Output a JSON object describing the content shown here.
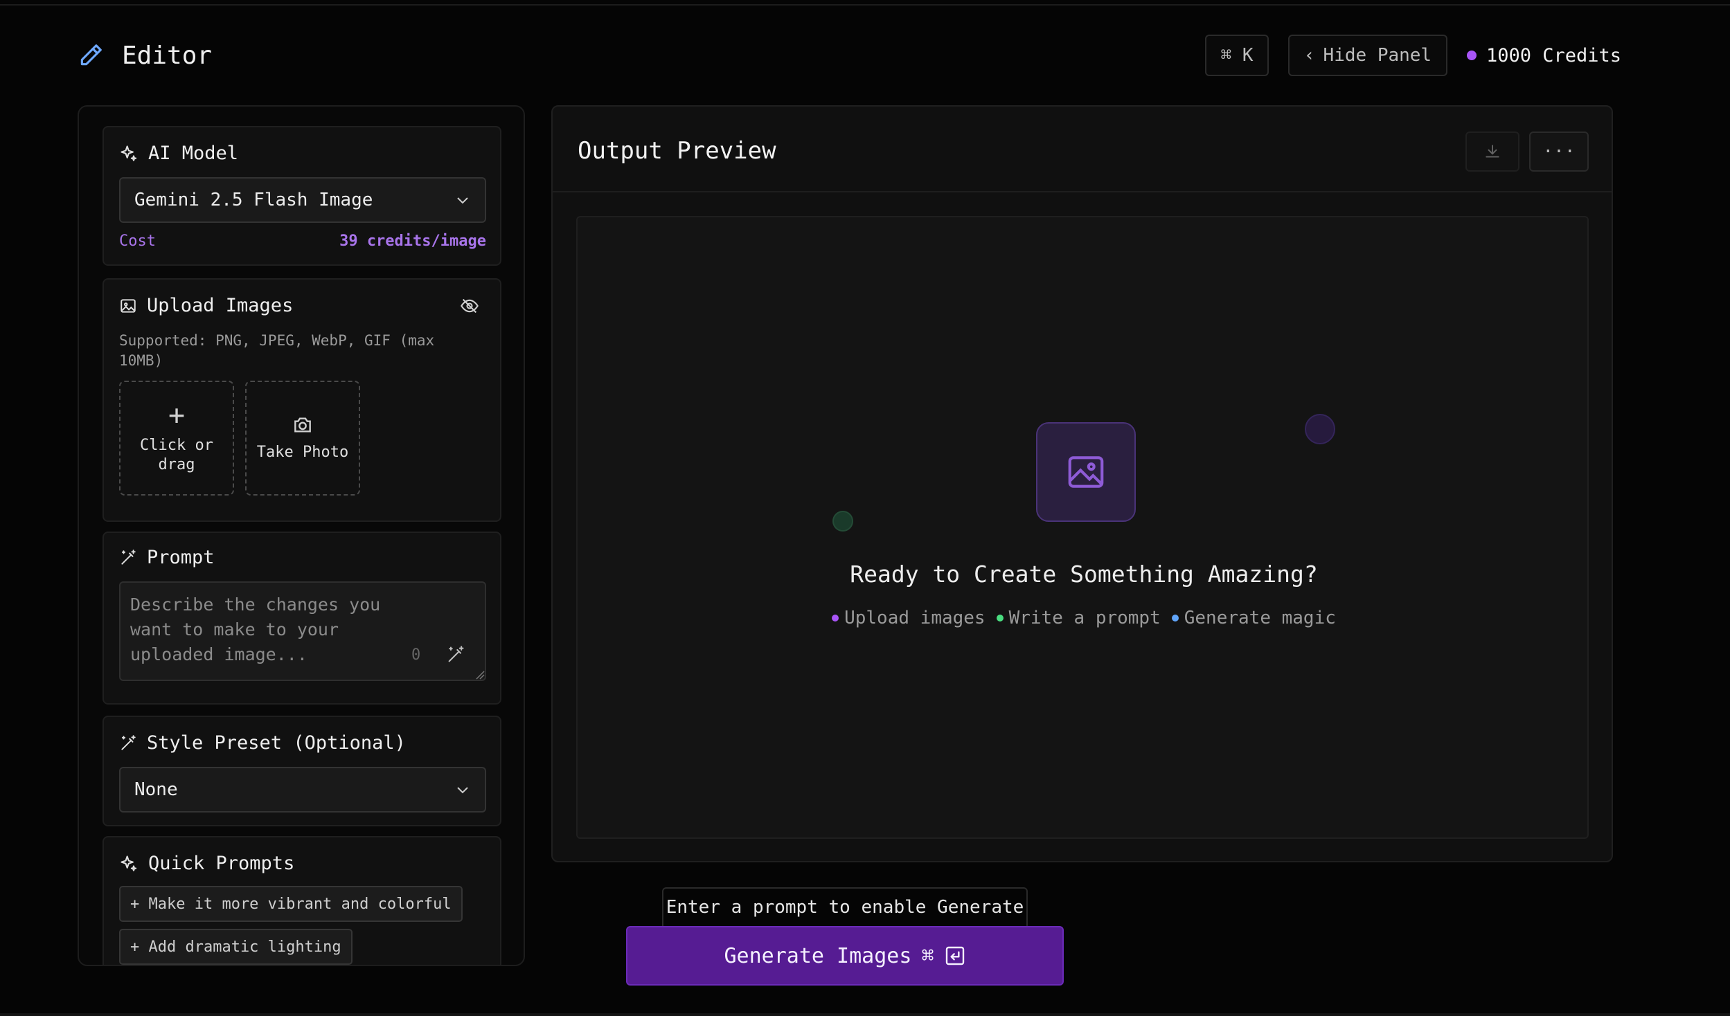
{
  "header": {
    "title": "Editor",
    "shortcut_label": "⌘ K",
    "hide_panel_label": "Hide Panel",
    "credits_label": "1000 Credits"
  },
  "ai_model": {
    "heading": "AI Model",
    "selected": "Gemini 2.5 Flash Image",
    "cost_label": "Cost",
    "cost_value": "39 credits/image"
  },
  "upload": {
    "heading": "Upload Images",
    "supported": "Supported: PNG, JPEG, WebP, GIF (max 10MB)",
    "click_label": "Click or drag",
    "photo_label": "Take Photo"
  },
  "prompt": {
    "heading": "Prompt",
    "placeholder": "Describe the changes you want to make to your uploaded image...",
    "count": "0"
  },
  "style_preset": {
    "heading": "Style Preset (Optional)",
    "selected": "None"
  },
  "quick_prompts": {
    "heading": "Quick Prompts",
    "items": [
      "+ Make it more vibrant and colorful",
      "+ Add dramatic lighting"
    ]
  },
  "output": {
    "title": "Output Preview",
    "more_label": "···",
    "ready_text": "Ready to Create Something Amazing?",
    "steps": [
      "Upload images",
      "Write a prompt",
      "Generate magic"
    ]
  },
  "generate": {
    "hint": "Enter a prompt to enable Generate",
    "label": "Generate Images"
  },
  "colors": {
    "accent": "#a855f7",
    "green": "#4ade80",
    "blue": "#60a5fa",
    "generate_bg": "#561c93"
  }
}
